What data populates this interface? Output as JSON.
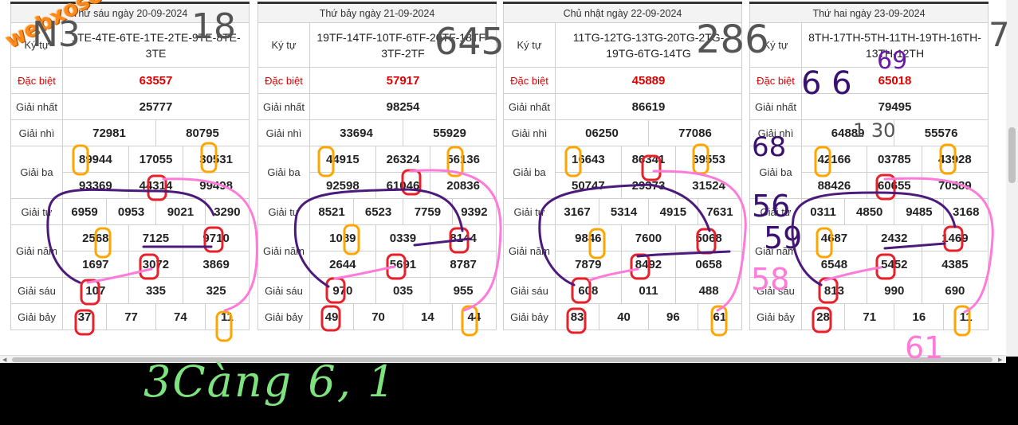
{
  "labels": {
    "ky_tu": "Ký tự",
    "dac_biet": "Đặc biệt",
    "giai_nhat": "Giải nhất",
    "giai_nhi": "Giải nhì",
    "giai_ba": "Giải ba",
    "giai_tu": "Giải tư",
    "giai_nam": "Giải năm",
    "giai_sau": "Giải sáu",
    "giai_bay": "Giải bảy"
  },
  "logo": "webxoso.net",
  "days": [
    {
      "date": "Thứ sáu ngày 20-09-2024",
      "ky_tu": "1TE-4TE-6TE-1TE-2TE-9TE-8TE-3TE",
      "dac_biet": "63557",
      "giai_nhat": "25777",
      "giai_nhi": [
        "72981",
        "80795"
      ],
      "giai_ba": [
        "89944",
        "17055",
        "30531",
        "93369",
        "44314",
        "99498"
      ],
      "giai_tu": [
        "6959",
        "0953",
        "9021",
        "3290"
      ],
      "giai_nam": [
        "2568",
        "7125",
        "9710",
        "1697",
        "3072",
        "3869"
      ],
      "giai_sau": [
        "107",
        "335",
        "325"
      ],
      "giai_bay": [
        "37",
        "77",
        "74",
        "11"
      ]
    },
    {
      "date": "Thứ bảy ngày 21-09-2024",
      "ky_tu": "19TF-14TF-10TF-6TF-20TF-18TF-3TF-2TF",
      "dac_biet": "57917",
      "giai_nhat": "98254",
      "giai_nhi": [
        "33694",
        "55929"
      ],
      "giai_ba": [
        "44915",
        "26324",
        "56136",
        "92598",
        "61046",
        "20836"
      ],
      "giai_tu": [
        "8521",
        "6523",
        "7759",
        "9392"
      ],
      "giai_nam": [
        "1089",
        "0339",
        "8144",
        "2644",
        "5691",
        "8787"
      ],
      "giai_sau": [
        "970",
        "035",
        "955"
      ],
      "giai_bay": [
        "49",
        "70",
        "14",
        "44"
      ]
    },
    {
      "date": "Chủ nhật ngày 22-09-2024",
      "ky_tu": "11TG-12TG-13TG-20TG-2TG-19TG-6TG-14TG",
      "dac_biet": "45889",
      "giai_nhat": "86619",
      "giai_nhi": [
        "06250",
        "77086"
      ],
      "giai_ba": [
        "16643",
        "86341",
        "69553",
        "50747",
        "29373",
        "31524"
      ],
      "giai_tu": [
        "3167",
        "5314",
        "4915",
        "7631"
      ],
      "giai_nam": [
        "9846",
        "7600",
        "5068",
        "7879",
        "8492",
        "0658"
      ],
      "giai_sau": [
        "608",
        "011",
        "488"
      ],
      "giai_bay": [
        "83",
        "40",
        "96",
        "61"
      ]
    },
    {
      "date": "Thứ hai ngày 23-09-2024",
      "ky_tu": "8TH-17TH-5TH-11TH-19TH-16TH-13TH-12TH",
      "dac_biet": "65018",
      "giai_nhat": "79495",
      "giai_nhi": [
        "64889",
        "55576"
      ],
      "giai_ba": [
        "42166",
        "03785",
        "43928",
        "88426",
        "60655",
        "70589"
      ],
      "giai_tu": [
        "0311",
        "4850",
        "9485",
        "3168"
      ],
      "giai_nam": [
        "4687",
        "2432",
        "1469",
        "6548",
        "5452",
        "4385"
      ],
      "giai_sau": [
        "813",
        "990",
        "690"
      ],
      "giai_bay": [
        "28",
        "71",
        "16",
        "11"
      ]
    }
  ],
  "handwritten": {
    "top_left": "N3",
    "top_18": "18",
    "top_645": "645",
    "top_286": "286",
    "top_7": "7",
    "mid_69": "69",
    "mid_66": "6 6",
    "mid_130": "1 30",
    "mid_68": "68",
    "mid_56": "56",
    "mid_59": "59",
    "mid_58": "58",
    "mid_61": "61",
    "bottom_note": "3Càng  6, 1"
  },
  "colors": {
    "red_numbers": "#dd0000",
    "marker_orange": "#ffa500",
    "marker_red": "#e8202a",
    "marker_purple": "#4b1a7a",
    "marker_pink": "#ff7ad9",
    "marker_gray": "#555555",
    "marker_green": "#7ee37e",
    "logo_orange": "#ff8a1a"
  }
}
